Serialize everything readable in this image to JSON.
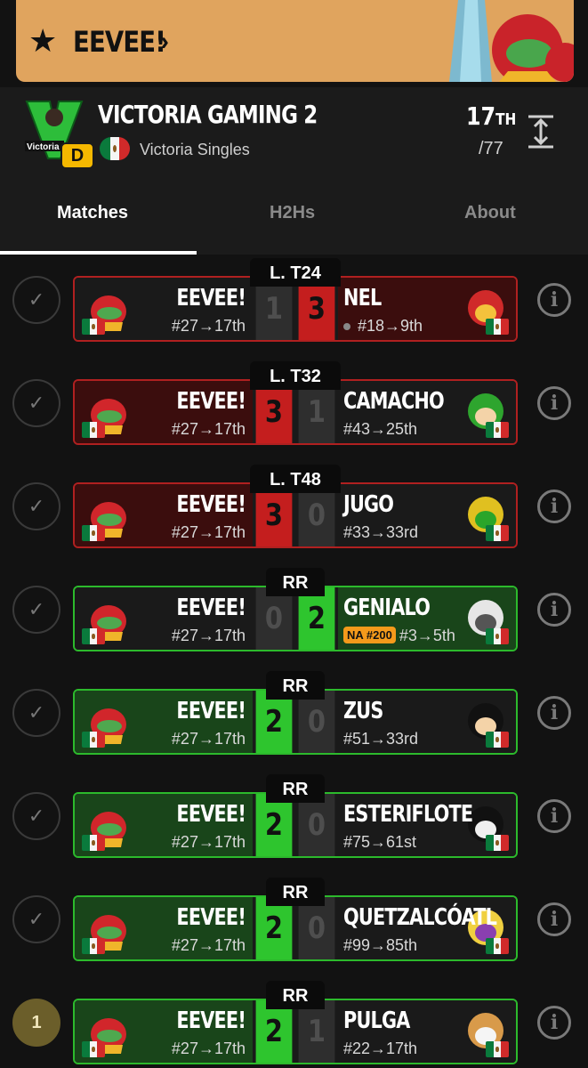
{
  "banner": {
    "player": "EEVEE!",
    "star_icon": "star-icon",
    "chevron": "›"
  },
  "header": {
    "team": "VICTORIA GAMING 2",
    "tier": "D",
    "league": "Victoria Singles",
    "place": "17",
    "place_suffix": "TH",
    "total": "/77"
  },
  "tabs": [
    {
      "label": "Matches",
      "active": true
    },
    {
      "label": "H2Hs",
      "active": false
    },
    {
      "label": "About",
      "active": false
    }
  ],
  "colors": {
    "loss": "#c41e1e",
    "win": "#2ec52e",
    "badge": "#f5b800"
  },
  "matches": [
    {
      "round": "L. T24",
      "status": "✓",
      "left_name": "EEVEE!",
      "left_seed": "#27→17th",
      "left_score": "1",
      "right_score": "3",
      "right_name": "NEL",
      "right_seed": "#18→9th",
      "result": "loss",
      "right_char": "captain-falcon",
      "dot": true
    },
    {
      "round": "L. T32",
      "status": "✓",
      "left_name": "EEVEE!",
      "left_seed": "#27→17th",
      "left_score": "3",
      "right_score": "1",
      "right_name": "CAMACHO",
      "right_seed": "#43→25th",
      "result": "win-red",
      "right_char": "luigi"
    },
    {
      "round": "L. T48",
      "status": "✓",
      "left_name": "EEVEE!",
      "left_seed": "#27→17th",
      "left_score": "3",
      "right_score": "0",
      "right_name": "JUGO",
      "right_seed": "#33→33rd",
      "result": "win-red",
      "right_char": "bowser"
    },
    {
      "round": "RR",
      "status": "✓",
      "left_name": "EEVEE!",
      "left_seed": "#27→17th",
      "left_score": "0",
      "right_score": "2",
      "right_name": "GENIALO",
      "right_seed": "#3→5th",
      "badge": "NA #200",
      "result": "loss-green",
      "right_char": "rob"
    },
    {
      "round": "RR",
      "status": "✓",
      "left_name": "EEVEE!",
      "left_seed": "#27→17th",
      "left_score": "2",
      "right_score": "0",
      "right_name": "ZUS",
      "right_seed": "#51→33rd",
      "result": "win",
      "right_char": "mr-game-and-watch"
    },
    {
      "round": "RR",
      "status": "✓",
      "left_name": "EEVEE!",
      "left_seed": "#27→17th",
      "left_score": "2",
      "right_score": "0",
      "right_name": "ESTERIFLOTE",
      "right_seed": "#75→61st",
      "result": "win",
      "right_char": "joker"
    },
    {
      "round": "RR",
      "status": "✓",
      "left_name": "EEVEE!",
      "left_seed": "#27→17th",
      "left_score": "2",
      "right_score": "0",
      "right_name": "QUETZALCÓATL",
      "right_seed": "#99→85th",
      "result": "win",
      "right_char": "wario"
    },
    {
      "round": "RR",
      "status": "1",
      "left_name": "EEVEE!",
      "left_seed": "#27→17th",
      "left_score": "2",
      "right_score": "1",
      "right_name": "PULGA",
      "right_seed": "#22→17th",
      "result": "win",
      "right_char": "fox"
    }
  ]
}
